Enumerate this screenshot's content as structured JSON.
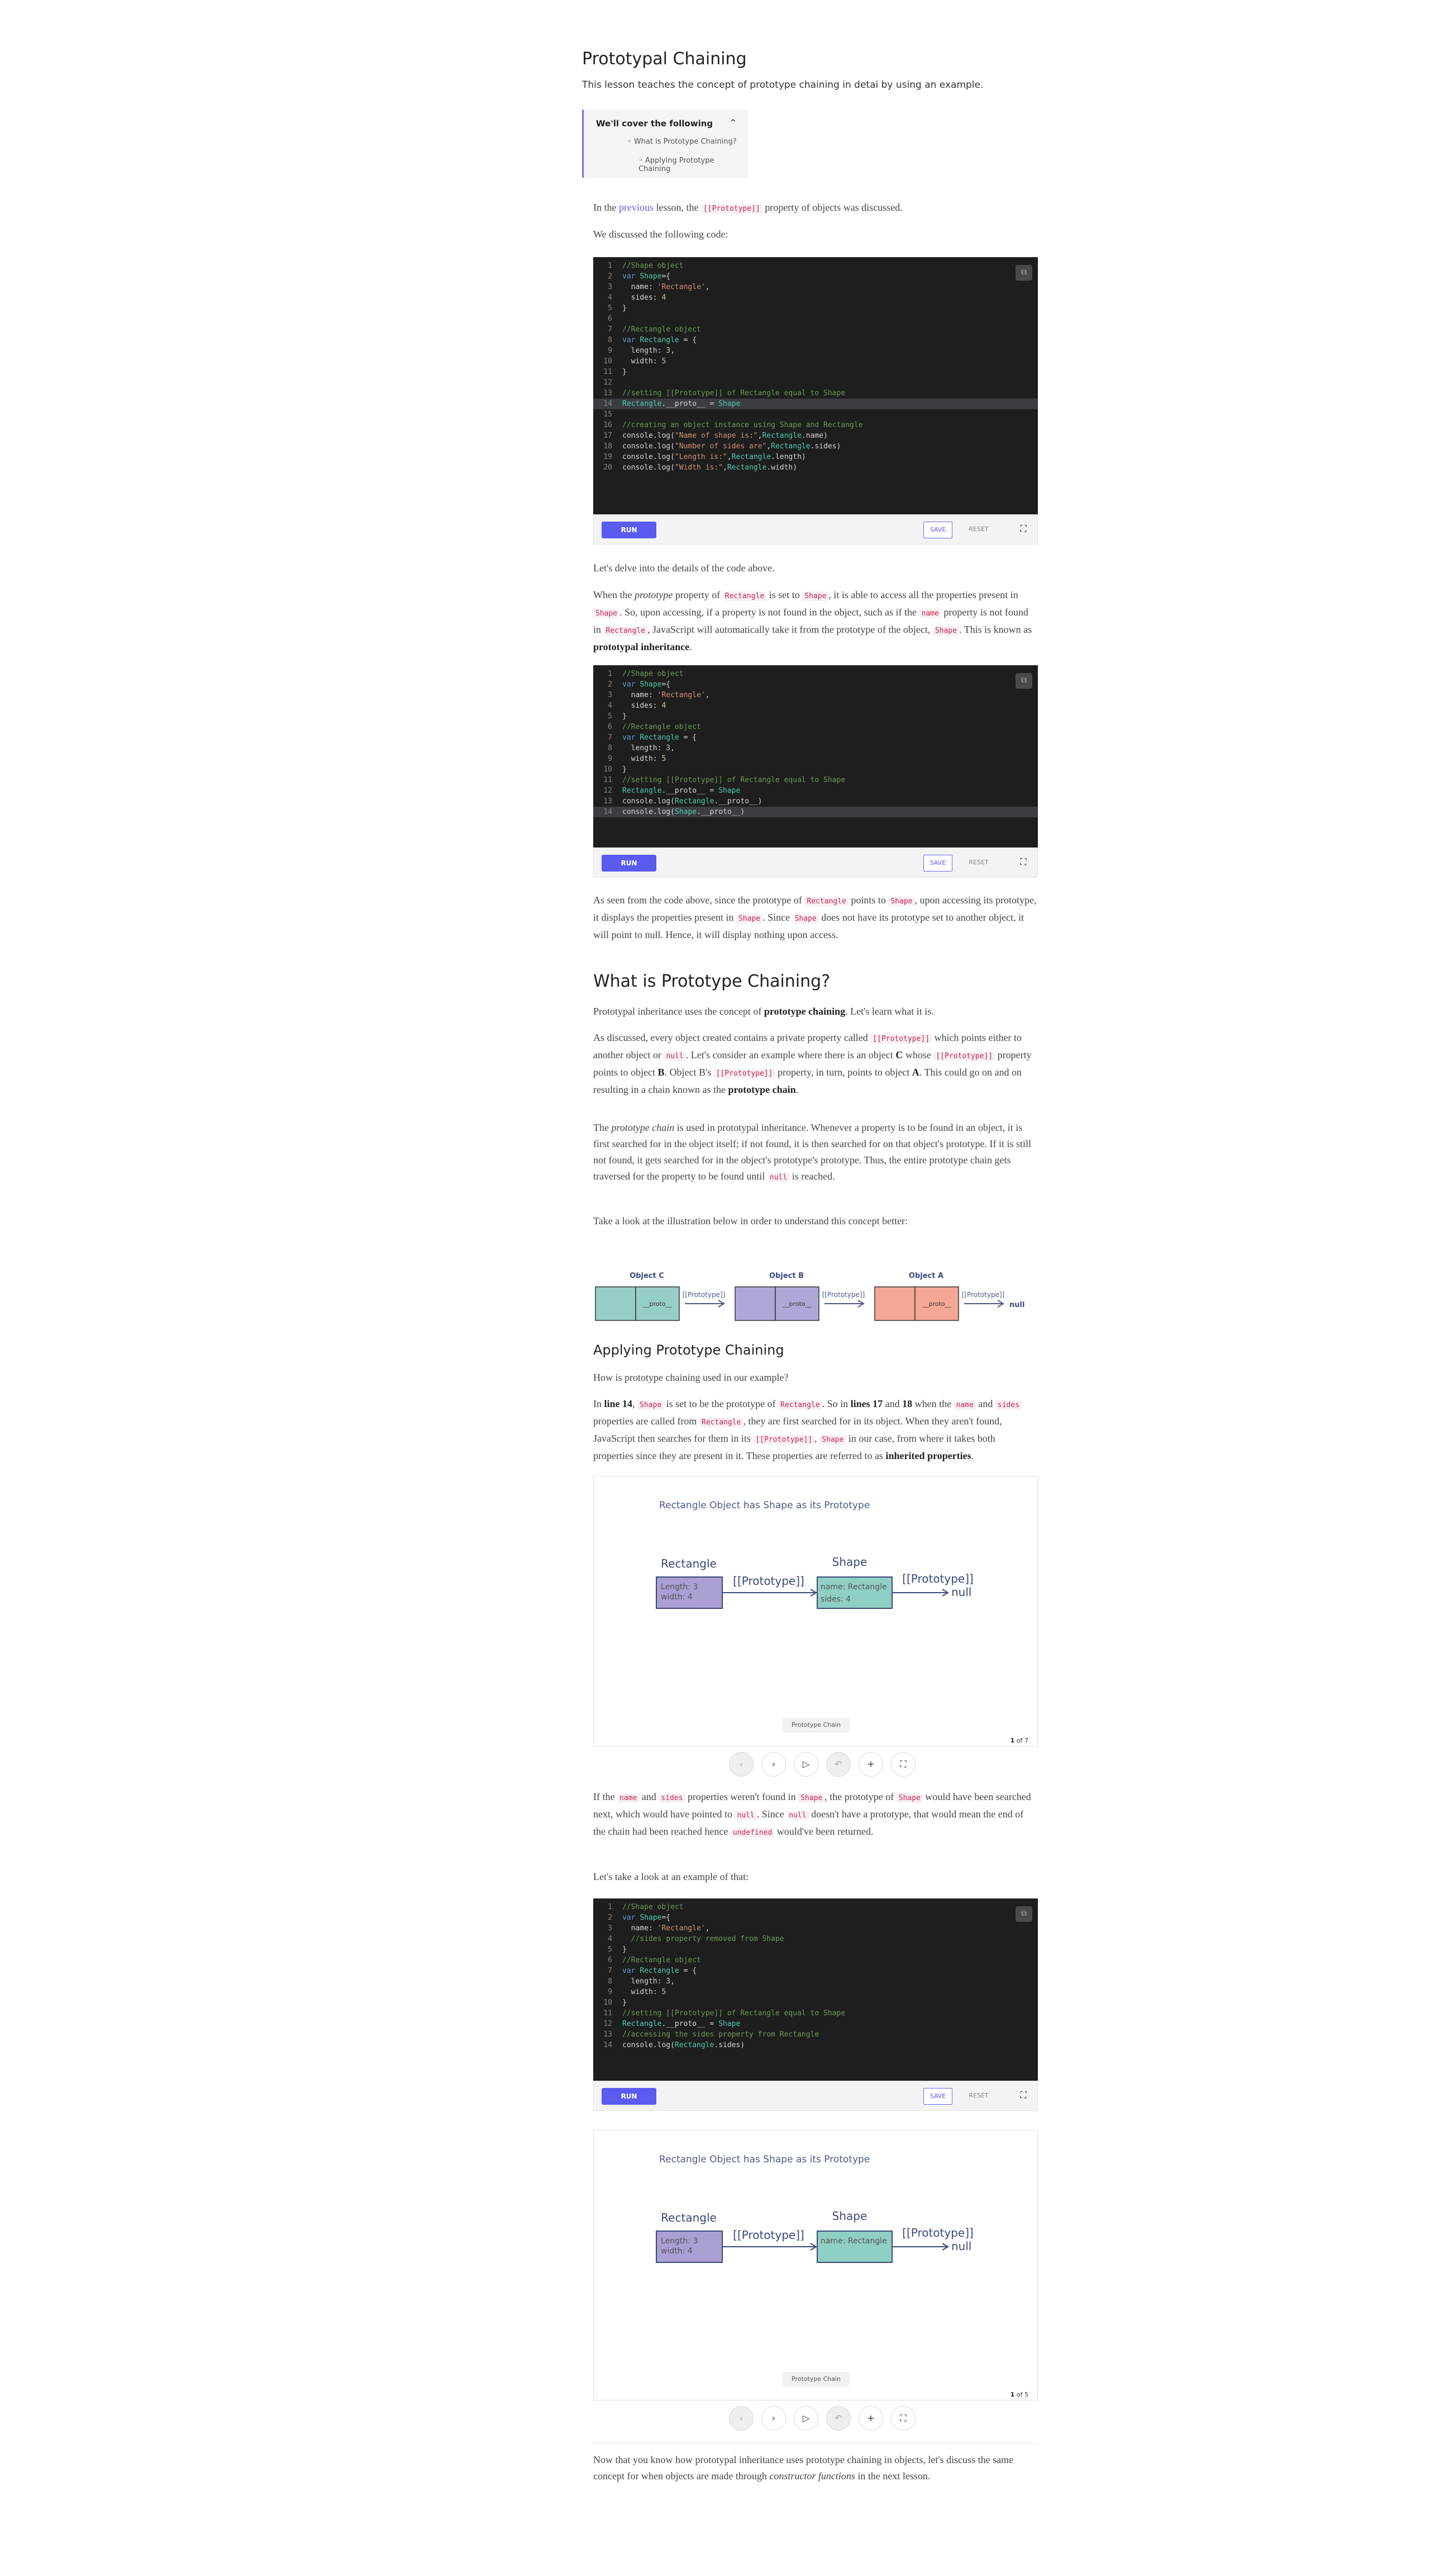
{
  "lesson": {
    "title": "Prototypal Chaining",
    "intro": "This lesson teaches the concept of prototype chaining in detai by using an example."
  },
  "toc": {
    "heading": "We'll cover the following",
    "items": [
      "What is Prototype Chaining?",
      "Applying Prototype Chaining"
    ]
  },
  "paragraphs": {
    "p1_a": "In the ",
    "p1_link": "previous",
    "p1_b": " lesson, the ",
    "p1_code": "[[Prototype]]",
    "p1_c": " property of objects was discussed.",
    "p2": "We discussed the following code:",
    "p3": "Let's delve into the details of the code above.",
    "p4": [
      "When the ",
      "prototype",
      " property of ",
      "Rectangle",
      " is set to ",
      "Shape",
      ", it is able to access all the properties present in ",
      "Shape",
      ". So, upon accessing, if a property is not found in the object, such as if the ",
      "name",
      " property is not found in ",
      "Rectangle",
      ", JavaScript will automatically take it from the prototype of the object, ",
      "Shape",
      ". This is known as ",
      "prototypal inheritance",
      "."
    ],
    "p5": [
      "As seen from the code above, since the prototype of ",
      "Rectangle",
      " points to ",
      "Shape",
      ", upon accessing its prototype, it displays the properties present in ",
      "Shape",
      ". Since ",
      "Shape",
      " does not have its prototype set to another object, it will point to null. Hence, it will display nothing upon access."
    ],
    "h2_1": "What is Prototype Chaining?",
    "p6": [
      "Prototypal inheritance uses the concept of ",
      "prototype chaining",
      ". Let's learn what it is."
    ],
    "p7": [
      "As discussed, every object created contains a private property called ",
      "[[Prototype]]",
      " which points either to another object or ",
      "null",
      ". Let's consider an example where there is an object ",
      "C",
      " whose ",
      "[[Prototype]]",
      " property points to object ",
      "B",
      ". Object B's ",
      "[[Prototype]]",
      " property, in turn, points to object ",
      "A",
      ". This could go on and on resulting in a chain known as the ",
      "prototype chain",
      "."
    ],
    "p8": [
      "The ",
      "prototype chain",
      " is used in prototypal inheritance. Whenever a property is to be found in an object, it is first searched for in the object itself; if not found, it is then searched for on that object's prototype. If it is still not found, it gets searched for in the object's prototype's prototype. Thus, the entire prototype chain gets traversed for the property to be found until ",
      "null",
      " is reached."
    ],
    "p9": "Take a look at the illustration below in order to understand this concept better:",
    "h3_1": "Applying Prototype Chaining",
    "p10": "How is prototype chaining used in our example?",
    "p11": [
      "In ",
      "line 14",
      ", ",
      "Shape",
      " is set to be the prototype of ",
      "Rectangle",
      ". So in ",
      "lines 17",
      " and ",
      "18",
      " when the ",
      "name",
      " and ",
      "sides",
      " properties are called from ",
      "Rectangle",
      ", they are first searched for in its object. When they aren't found, JavaScript then searches for them in its ",
      "[[Prototype]]",
      ", ",
      "Shape",
      " in our case, from where it takes both properties since they are present in it. These properties are referred to as ",
      "inherited properties",
      "."
    ],
    "p12": [
      "If the ",
      "name",
      " and ",
      "sides",
      " properties weren't found in ",
      "Shape",
      ", the prototype of ",
      "Shape",
      " would have been searched next, which would have pointed to ",
      "null",
      ". Since ",
      "null",
      " doesn't have a prototype, that would mean the end of the chain had been reached hence ",
      "undefined",
      " would've been returned."
    ],
    "p13": "Let's take a look at an example of that:",
    "p14": [
      "Now that you know how prototypal inheritance uses prototype chaining in objects, let's discuss the same concept for when objects are made through ",
      "constructor functions",
      " in the next lesson."
    ]
  },
  "editor_buttons": {
    "run": "RUN",
    "save": "SAVE",
    "reset": "RESET"
  },
  "code1": [
    "//Shape object",
    "var Shape={",
    "  name: 'Rectangle',",
    "  sides: 4",
    "}",
    "",
    "//Rectangle object",
    "var Rectangle = {",
    "  length: 3,",
    "  width: 5",
    "}",
    "",
    "//setting [[Prototype]] of Rectangle equal to Shape",
    "Rectangle.__proto__ = Shape",
    "",
    "//creating an object instance using Shape and Rectangle",
    "console.log(\"Name of shape is:\",Rectangle.name)",
    "console.log(\"Number of sides are\",Rectangle.sides)",
    "console.log(\"Length is:\",Rectangle.length)",
    "console.log(\"Width is:\",Rectangle.width)"
  ],
  "code2": [
    "//Shape object",
    "var Shape={",
    "  name: 'Rectangle',",
    "  sides: 4",
    "}",
    "//Rectangle object",
    "var Rectangle = {",
    "  length: 3,",
    "  width: 5",
    "}",
    "//setting [[Prototype]] of Rectangle equal to Shape",
    "Rectangle.__proto__ = Shape",
    "console.log(Rectangle.__proto__)",
    "console.log(Shape.__proto__)"
  ],
  "code3": [
    "//Shape object",
    "var Shape={",
    "  name: 'Rectangle',",
    "  //sides property removed from Shape",
    "}",
    "//Rectangle object",
    "var Rectangle = {",
    "  length: 3,",
    "  width: 5",
    "}",
    "//setting [[Prototype]] of Rectangle equal to Shape",
    "Rectangle.__proto__ = Shape",
    "//accessing the sides property from Rectangle",
    "console.log(Rectangle.sides)"
  ],
  "chain_diagram": {
    "objects": [
      {
        "label": "Object C",
        "slot": "__proto__",
        "color": "#96cfc6"
      },
      {
        "label": "Object B",
        "slot": "__proto__",
        "color": "#b1a6d8"
      },
      {
        "label": "Object A",
        "slot": "__proto__",
        "color": "#f5a795"
      }
    ],
    "arrow_label": "[[Prototype]]",
    "end": "null"
  },
  "slides": [
    {
      "caption": "Rectangle Object has Shape as its Prototype",
      "left_title": "Rectangle",
      "left_lines": [
        "Length: 3",
        "width: 4"
      ],
      "right_title": "Shape",
      "right_lines": [
        "name: Rectangle",
        "sides: 4"
      ],
      "arrow_label": "[[Prototype]]",
      "end_label": "[[Prototype]]",
      "end": "null",
      "footer": "Prototype Chain",
      "counter_cur": "1",
      "counter_rest": " of 7"
    },
    {
      "caption": "Rectangle Object has Shape as its Prototype",
      "left_title": "Rectangle",
      "left_lines": [
        "Length: 3",
        "width: 4"
      ],
      "right_title": "Shape",
      "right_lines": [
        "name: Rectangle"
      ],
      "arrow_label": "[[Prototype]]",
      "end_label": "[[Prototype]]",
      "end": "null",
      "footer": "Prototype Chain",
      "counter_cur": "1",
      "counter_rest": " of 5"
    }
  ],
  "slide_controls": [
    "‹",
    "›",
    "▷",
    "↶",
    "+",
    "⛶"
  ]
}
